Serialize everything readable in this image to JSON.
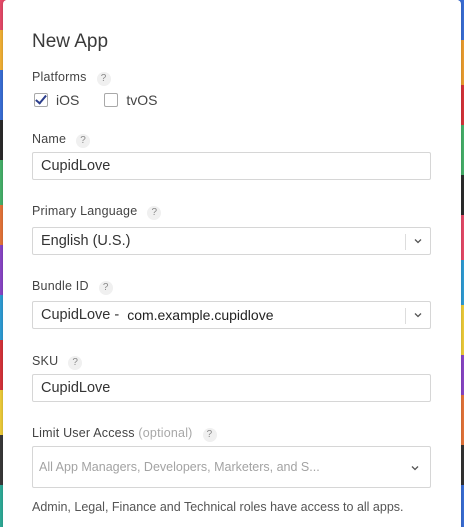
{
  "dialog": {
    "title": "New App"
  },
  "platforms": {
    "label": "Platforms",
    "help": "?",
    "options": [
      {
        "label": "iOS",
        "checked": true
      },
      {
        "label": "tvOS",
        "checked": false
      }
    ]
  },
  "name": {
    "label": "Name",
    "help": "?",
    "value": "CupidLove"
  },
  "primary_language": {
    "label": "Primary Language",
    "help": "?",
    "selected": "English (U.S.)"
  },
  "bundle_id": {
    "label": "Bundle ID",
    "help": "?",
    "prefix": "CupidLove -",
    "value": "com.example.cupidlove"
  },
  "sku": {
    "label": "SKU",
    "help": "?",
    "value": "CupidLove"
  },
  "user_access": {
    "label": "Limit User Access",
    "optional": "(optional)",
    "help": "?",
    "placeholder": "All App Managers, Developers, Marketers, and S..."
  },
  "note": "Admin, Legal, Finance and Technical roles have access to all apps.",
  "colors": {
    "check": "#2c3e8c",
    "border": "#d6d6d6",
    "placeholder": "#a3a3a3",
    "help_badge": "#f0f0f0"
  }
}
